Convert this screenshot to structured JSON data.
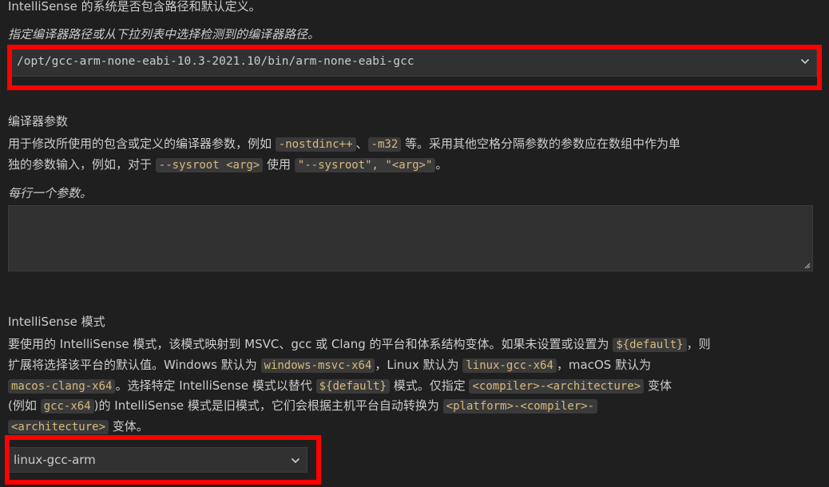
{
  "top_desc": "IntelliSense 的系统是否包含路径和默认定义。",
  "compiler_path": {
    "hint": "指定编译器路径或从下拉列表中选择检测到的编译器路径。",
    "value": "/opt/gcc-arm-none-eabi-10.3-2021.10/bin/arm-none-eabi-gcc"
  },
  "compiler_args": {
    "title": "编译器参数",
    "desc1_a": "用于修改所使用的包含或定义的编译器参数，例如",
    "code1": "-nostdinc++",
    "sep1": "、",
    "code2": "-m32",
    "desc1_b": "等。采用其他空格分隔参数的参数应在数组中作为单",
    "desc2_a": "独的参数输入，例如，对于",
    "code3": "--sysroot <arg>",
    "desc2_b": "使用",
    "code4": "\"--sysroot\", \"<arg>\"",
    "desc2_c": "。",
    "hint": "每行一个参数。",
    "value": ""
  },
  "intellisense_mode": {
    "title": "IntelliSense 模式",
    "l1_a": "要使用的 IntelliSense 模式，该模式映射到 MSVC、gcc 或 Clang 的平台和体系结构变体。如果未设置或设置为",
    "l1_code": "${default}",
    "l1_b": "，则",
    "l2_a": "扩展将选择该平台的默认值。Windows 默认为",
    "l2_code1": "windows-msvc-x64",
    "l2_b": "，Linux 默认为",
    "l2_code2": "linux-gcc-x64",
    "l2_c": "，macOS 默认为",
    "l3_code1": "macos-clang-x64",
    "l3_a": "。选择特定 IntelliSense 模式以替代",
    "l3_code2": "${default}",
    "l3_b": "模式。仅指定",
    "l3_code3": "<compiler>-<architecture>",
    "l3_c": "变体",
    "l4_a": "(例如",
    "l4_code1": "gcc-x64",
    "l4_b": ")的 IntelliSense 模式是旧模式，它们会根据主机平台自动转换为",
    "l4_code2": "<platform>-<compiler>-",
    "l5_code": "<architecture>",
    "l5_a": "变体。",
    "value": "linux-gcc-arm"
  },
  "colors": {
    "background": "#1f1f1f",
    "code_text": "#d7ba7d",
    "highlight_box": "#ff0000"
  },
  "icons": {
    "dropdown": "chevron-down-icon",
    "resize": "resize-grip-icon"
  }
}
